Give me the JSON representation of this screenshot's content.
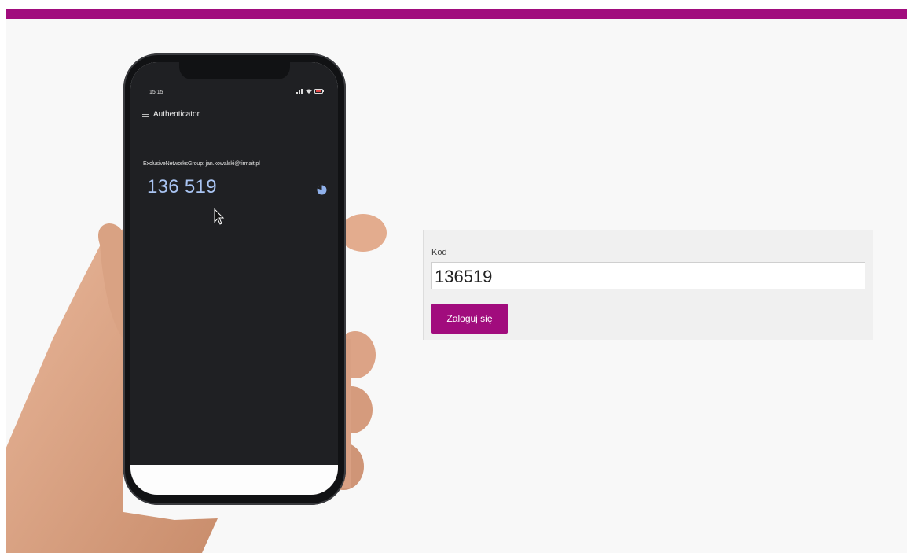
{
  "colors": {
    "brand": "#a10c7d",
    "page_bg": "#f8f8f8",
    "app_bg": "#1f2023",
    "otp_code": "#a9c4f2"
  },
  "phone": {
    "status_time": "15:15",
    "status_icons": [
      "signal-icon",
      "wifi-icon",
      "battery-icon"
    ],
    "app_title": "Authenticator",
    "menu_icon": "hamburger-menu-icon",
    "account_label": "ExclusiveNetworksGroup: jan.kowalski@firmait.pl",
    "otp_code": "136 519",
    "timer_icon": "countdown-timer-icon",
    "cursor_icon": "mouse-pointer-icon"
  },
  "login_form": {
    "code_label": "Kod",
    "code_value": "136519",
    "submit_label": "Zaloguj się"
  }
}
